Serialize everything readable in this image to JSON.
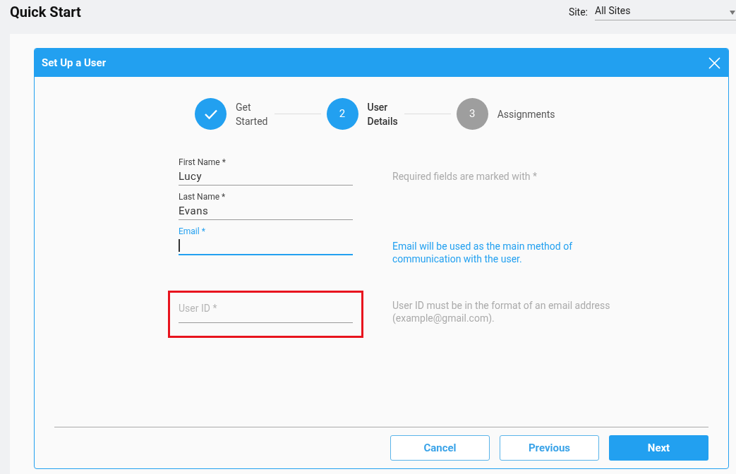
{
  "page": {
    "title": "Quick Start",
    "site_label": "Site:",
    "site_value": "All Sites"
  },
  "dialog": {
    "title": "Set Up a User",
    "steps": [
      {
        "label": "Get Started",
        "completed": true,
        "selected": false
      },
      {
        "number": "2",
        "label": "User Details",
        "completed": false,
        "selected": true
      },
      {
        "number": "3",
        "label": "Assignments",
        "completed": false,
        "selected": false
      }
    ],
    "fields": [
      {
        "label": "First Name *",
        "value": "Lucy",
        "focused": false,
        "highlighted": false,
        "hint": "Required fields are marked with *",
        "hint_emphasized": false
      },
      {
        "label": "Last Name *",
        "value": "Evans",
        "focused": false,
        "highlighted": false
      },
      {
        "label": "Email *",
        "focused": true,
        "highlighted": false,
        "hint": "Email will be used as the main method of communication with the user.",
        "hint_emphasized": true
      },
      {
        "label": "User ID *",
        "focused": false,
        "highlighted": true,
        "hint": "User ID must be in the format of an email address (example@gmail.com).",
        "hint_emphasized": false
      }
    ],
    "buttons": [
      {
        "label": "Cancel",
        "kind": "secondary"
      },
      {
        "label": "Previous",
        "kind": "secondary"
      },
      {
        "label": "Next",
        "kind": "primary"
      }
    ]
  }
}
